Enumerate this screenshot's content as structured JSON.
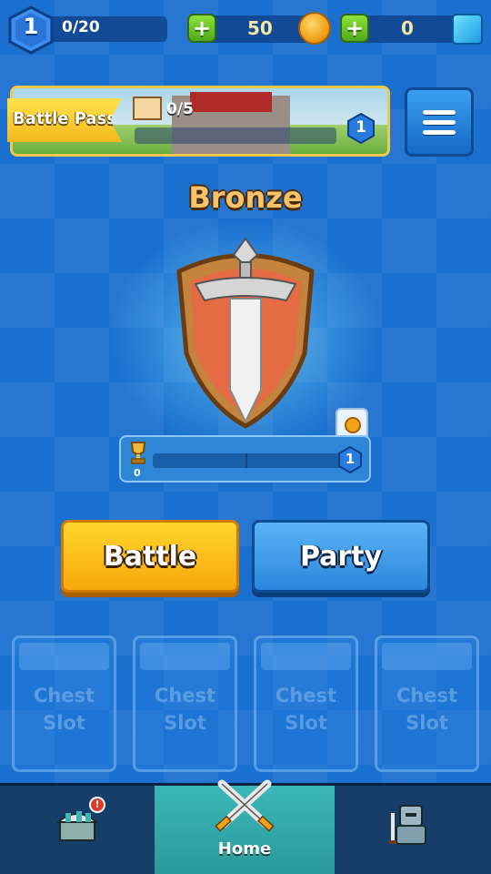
{
  "header": {
    "player_level": "1",
    "xp_progress": "0/20",
    "coins": "50",
    "gems": "0",
    "add_coins_label": "+",
    "add_gems_label": "+"
  },
  "battle_pass": {
    "label": "Battle Pass",
    "tower_progress": "0/5",
    "level": "1"
  },
  "rank": {
    "name": "Bronze",
    "trophies": "0",
    "next_level": "1"
  },
  "actions": {
    "battle_label": "Battle",
    "party_label": "Party"
  },
  "chest_slots": [
    {
      "label": "Chest\nSlot"
    },
    {
      "label": "Chest\nSlot"
    },
    {
      "label": "Chest\nSlot"
    },
    {
      "label": "Chest\nSlot"
    }
  ],
  "nav": {
    "home_label": "Home",
    "shop_badge": "!",
    "active_tab": "Home"
  },
  "colors": {
    "background": "#1a6fcf",
    "battle_button": "#f6a80c",
    "party_button": "#2c86dc",
    "rank_title": "#f6c26b",
    "home_tab": "#2a9a9a"
  },
  "icons": [
    "level-hex-icon",
    "plus-icon",
    "coin-icon",
    "gem-icon",
    "tower-icon",
    "menu-icon",
    "bronze-shield-icon",
    "trophy-icon",
    "shop-icon",
    "crossed-swords-icon",
    "knight-icon"
  ]
}
